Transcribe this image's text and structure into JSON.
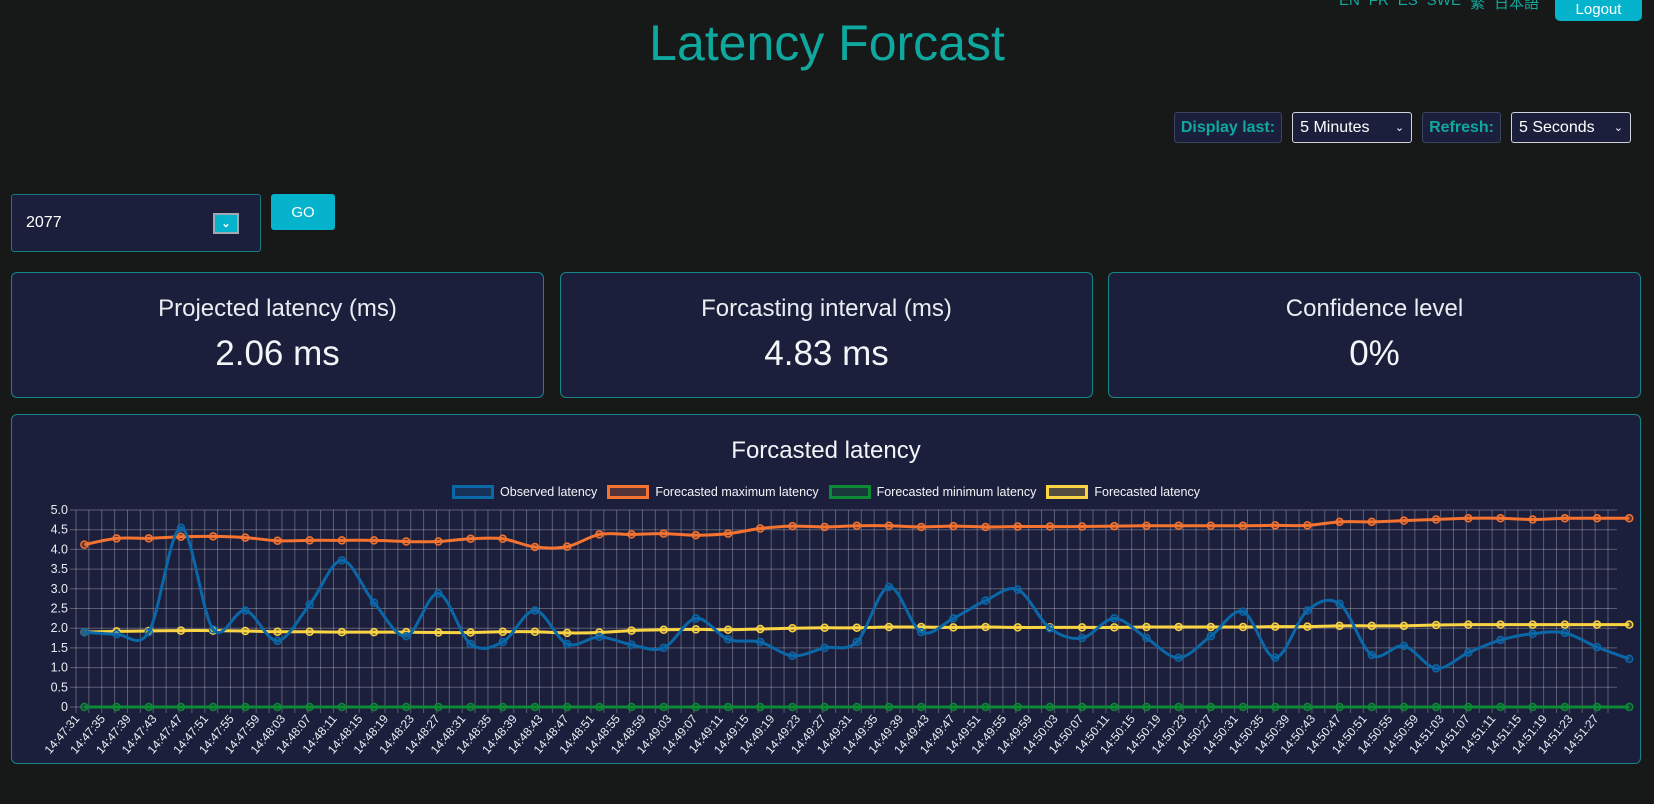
{
  "header": {
    "title": "Latency Forcast",
    "languages": [
      "EN",
      "FR",
      "ES",
      "SWE",
      "繁",
      "日本語"
    ],
    "logout_label": "Logout"
  },
  "controls": {
    "display_last_label": "Display last:",
    "display_last_value": "5 Minutes",
    "refresh_label": "Refresh:",
    "refresh_value": "5 Seconds"
  },
  "device": {
    "selected": "2077",
    "go_label": "GO"
  },
  "cards": [
    {
      "title": "Projected latency (ms)",
      "value": "2.06 ms"
    },
    {
      "title": "Forcasting interval (ms)",
      "value": "4.83 ms"
    },
    {
      "title": "Confidence level",
      "value": "0%"
    }
  ],
  "colors": {
    "accent": "#0fa89e",
    "button": "#06b3cc",
    "panel": "#1c1f3c",
    "background": "#171919"
  },
  "chart_data": {
    "type": "line",
    "title": "Forcasted latency",
    "xlabel": "",
    "ylabel": "",
    "ylim": [
      0,
      5
    ],
    "yticks": [
      "0",
      "0.5",
      "1.0",
      "1.5",
      "2.0",
      "2.5",
      "3.0",
      "3.5",
      "4.0",
      "4.5",
      "5.0"
    ],
    "grid": true,
    "legend_position": "top-center",
    "xtick_labels": [
      "14:47:31",
      "14:47:35",
      "14:47:39",
      "14:47:43",
      "14:47:47",
      "14:47:51",
      "14:47:55",
      "14:47:59",
      "14:48:03",
      "14:48:07",
      "14:48:11",
      "14:48:15",
      "14:48:19",
      "14:48:23",
      "14:48:27",
      "14:48:31",
      "14:48:35",
      "14:48:39",
      "14:48:43",
      "14:48:47",
      "14:48:51",
      "14:48:55",
      "14:48:59",
      "14:49:03",
      "14:49:07",
      "14:49:11",
      "14:49:15",
      "14:49:19",
      "14:49:23",
      "14:49:27",
      "14:49:31",
      "14:49:35",
      "14:49:39",
      "14:49:43",
      "14:49:47",
      "14:49:51",
      "14:49:55",
      "14:49:59",
      "14:50:03",
      "14:50:07",
      "14:50:11",
      "14:50:15",
      "14:50:19",
      "14:50:23",
      "14:50:27",
      "14:50:31",
      "14:50:35",
      "14:50:39",
      "14:50:43",
      "14:50:47",
      "14:50:51",
      "14:50:55",
      "14:50:59",
      "14:51:03",
      "14:51:07",
      "14:51:11",
      "14:51:15",
      "14:51:19",
      "14:51:23",
      "14:51:27"
    ],
    "x_start_seconds_after_first_tick": 1.3,
    "x_step_seconds": 5,
    "series": [
      {
        "name": "Observed latency",
        "color": "#0a67a8",
        "values": [
          1.9,
          1.85,
          1.9,
          4.55,
          1.97,
          2.45,
          1.68,
          2.6,
          3.72,
          2.65,
          1.8,
          2.88,
          1.6,
          1.65,
          2.45,
          1.6,
          1.78,
          1.58,
          1.5,
          2.25,
          1.72,
          1.65,
          1.3,
          1.5,
          1.65,
          3.05,
          1.9,
          2.25,
          2.7,
          2.98,
          2.0,
          1.75,
          2.25,
          1.75,
          1.25,
          1.8,
          2.42,
          1.25,
          2.45,
          2.62,
          1.32,
          1.55,
          0.98,
          1.38,
          1.7,
          1.86,
          1.88,
          1.52,
          1.22
        ]
      },
      {
        "name": "Forecasted maximum latency",
        "color": "#f57330",
        "values": [
          4.12,
          4.28,
          4.28,
          4.32,
          4.33,
          4.3,
          4.22,
          4.23,
          4.23,
          4.23,
          4.2,
          4.2,
          4.27,
          4.27,
          4.06,
          4.07,
          4.38,
          4.38,
          4.4,
          4.36,
          4.4,
          4.53,
          4.59,
          4.57,
          4.6,
          4.6,
          4.57,
          4.59,
          4.57,
          4.58,
          4.58,
          4.58,
          4.59,
          4.6,
          4.6,
          4.6,
          4.6,
          4.61,
          4.61,
          4.7,
          4.7,
          4.73,
          4.76,
          4.79,
          4.79,
          4.76,
          4.79,
          4.79,
          4.79
        ]
      },
      {
        "name": "Forecasted minimum latency",
        "color": "#0c8a35",
        "values": [
          0,
          0,
          0,
          0,
          0,
          0,
          0,
          0,
          0,
          0,
          0,
          0,
          0,
          0,
          0,
          0,
          0,
          0,
          0,
          0,
          0,
          0,
          0,
          0,
          0,
          0,
          0,
          0,
          0,
          0,
          0,
          0,
          0,
          0,
          0,
          0,
          0,
          0,
          0,
          0,
          0,
          0,
          0,
          0,
          0,
          0,
          0,
          0,
          0
        ]
      },
      {
        "name": "Forecasted latency",
        "color": "#fbd443",
        "values": [
          1.9,
          1.92,
          1.93,
          1.94,
          1.94,
          1.93,
          1.91,
          1.91,
          1.9,
          1.9,
          1.9,
          1.89,
          1.89,
          1.91,
          1.91,
          1.88,
          1.89,
          1.94,
          1.96,
          1.97,
          1.96,
          1.98,
          2.0,
          2.01,
          2.01,
          2.03,
          2.03,
          2.02,
          2.03,
          2.02,
          2.02,
          2.02,
          2.02,
          2.03,
          2.03,
          2.03,
          2.03,
          2.04,
          2.04,
          2.06,
          2.06,
          2.06,
          2.08,
          2.09,
          2.09,
          2.09,
          2.09,
          2.09,
          2.09
        ]
      }
    ]
  }
}
